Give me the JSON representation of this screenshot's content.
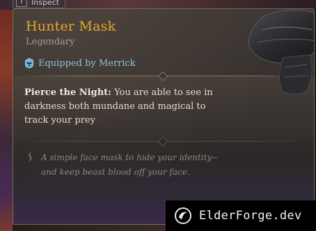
{
  "inspect": {
    "key": "T",
    "label": "Inspect"
  },
  "item": {
    "name": "Hunter Mask",
    "rarity": "Legendary",
    "equipped": "Equipped by Merrick",
    "passive_name": "Pierce the Night:",
    "passive_desc": " You are able to see in darkness both mundane and magical to track your prey",
    "flavor": "A simple face mask to hide your identity--and keep beast blood off your face."
  },
  "watermark": {
    "text": "ElderForge.dev"
  },
  "colors": {
    "title": "#e8a82a",
    "rarity": "#a89c90",
    "equipped": "#8fc4e0",
    "body_text": "#e6ddd0",
    "flavor_text": "#8e8680",
    "border": "#7a6a58"
  },
  "icons": {
    "equipped": "helmet-icon",
    "flavor": "quill-icon",
    "watermark": "elderforge-logo-icon"
  }
}
